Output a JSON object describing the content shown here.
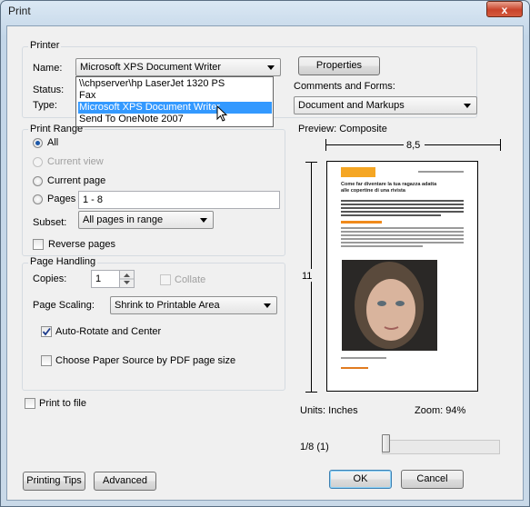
{
  "window": {
    "title": "Print",
    "close": "x"
  },
  "printer": {
    "group_label": "Printer",
    "name_label": "Name:",
    "name_value": "Microsoft XPS Document Writer",
    "status_label": "Status:",
    "type_label": "Type:",
    "properties_label": "Properties",
    "dropdown_options": [
      "\\\\chpserver\\hp LaserJet 1320 PS",
      "Fax",
      "Microsoft XPS Document Writer",
      "Send To OneNote 2007"
    ],
    "selected_index": 2
  },
  "comments": {
    "label": "Comments and Forms:",
    "value": "Document and Markups"
  },
  "print_range": {
    "group_label": "Print Range",
    "all": "All",
    "current_view": "Current view",
    "current_page": "Current page",
    "pages": "Pages",
    "pages_value": "1 - 8",
    "subset_label": "Subset:",
    "subset_value": "All pages in range",
    "reverse": "Reverse pages"
  },
  "page_handling": {
    "group_label": "Page Handling",
    "copies_label": "Copies:",
    "copies_value": "1",
    "collate": "Collate",
    "scaling_label": "Page Scaling:",
    "scaling_value": "Shrink to Printable Area",
    "auto_rotate": "Auto-Rotate and Center",
    "paper_source": "Choose Paper Source by PDF page size"
  },
  "print_to_file": "Print to file",
  "preview": {
    "label": "Preview: Composite",
    "width": "8,5",
    "height": "11",
    "units": "Units: Inches",
    "zoom": "Zoom:  94%",
    "page": "1/8 (1)",
    "slider_fraction": 0,
    "doc_title_line1": "Come far diventare la tua ragazza adatta",
    "doc_title_line2": "alle copertine di una rivista"
  },
  "buttons": {
    "tips": "Printing Tips",
    "advanced": "Advanced",
    "ok": "OK",
    "cancel": "Cancel"
  }
}
